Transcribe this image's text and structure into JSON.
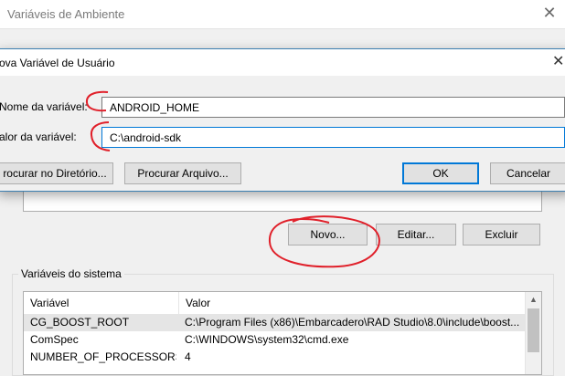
{
  "background_window": {
    "title": "Variáveis de Ambiente",
    "close_glyph": "✕",
    "buttons": {
      "new": "Novo...",
      "edit": "Editar...",
      "delete": "Excluir"
    },
    "system_group_label": "Variáveis do sistema",
    "system_columns": [
      "Variável",
      "Valor"
    ],
    "system_rows": [
      {
        "name": "CG_BOOST_ROOT",
        "value": "C:\\Program Files (x86)\\Embarcadero\\RAD Studio\\8.0\\include\\boost...",
        "selected": true
      },
      {
        "name": "ComSpec",
        "value": "C:\\WINDOWS\\system32\\cmd.exe",
        "selected": false
      },
      {
        "name": "NUMBER_OF_PROCESSORS",
        "value": "4",
        "selected": false
      }
    ]
  },
  "dialog": {
    "title": "ova Variável de Usuário",
    "close_glyph": "✕",
    "name_label": "Nome da variável:",
    "name_value": "ANDROID_HOME",
    "value_label": "alor da variável:",
    "value_value": "C:\\android-sdk",
    "buttons": {
      "browse_dir": "rocurar no Diretório...",
      "browse_file": "Procurar Arquivo...",
      "ok": "OK",
      "cancel": "Cancelar"
    }
  },
  "colors": {
    "accent": "#0078d7",
    "annotation": "#e0202a"
  },
  "icons": {
    "close": "close-icon",
    "scroll_up": "chevron-up-icon"
  }
}
